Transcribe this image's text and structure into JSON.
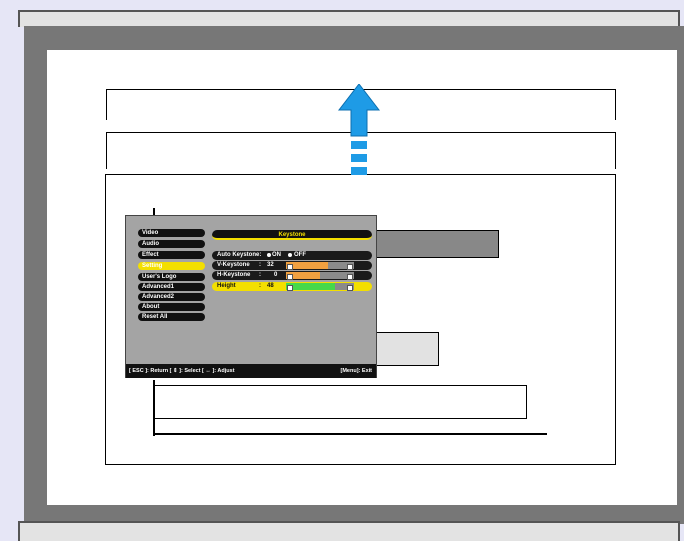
{
  "osd": {
    "menu_items": [
      "Video",
      "Audio",
      "Effect",
      "Setting",
      "User's Logo",
      "Advanced1",
      "Advanced2",
      "About",
      "Reset All"
    ],
    "active_item": "Setting",
    "title": "Keystone",
    "rows": {
      "auto_keystone": {
        "label": "Auto Keystone:",
        "on": "ON",
        "off": "OFF"
      },
      "v_keystone": {
        "label": "V-Keystone",
        "colon": ":",
        "value": "32",
        "level": 0.62
      },
      "h_keystone": {
        "label": "H-Keystone",
        "colon": ":",
        "value": "0",
        "level": 0.5
      },
      "height": {
        "label": "Height",
        "colon": ":",
        "value": "48",
        "level": 0.72
      }
    },
    "footer": {
      "left": "[ ESC ]: Return  [ ⇕ ]: Select  [ ↔ ]: Adjust",
      "right": "[Menu]: Exit"
    }
  },
  "colors": {
    "accent": "#f3df00",
    "arrow": "#1e9be6",
    "bar_orange": "#f0a040",
    "bar_green": "#46d84a"
  },
  "icons": {
    "direction": "arrow-up-icon"
  }
}
